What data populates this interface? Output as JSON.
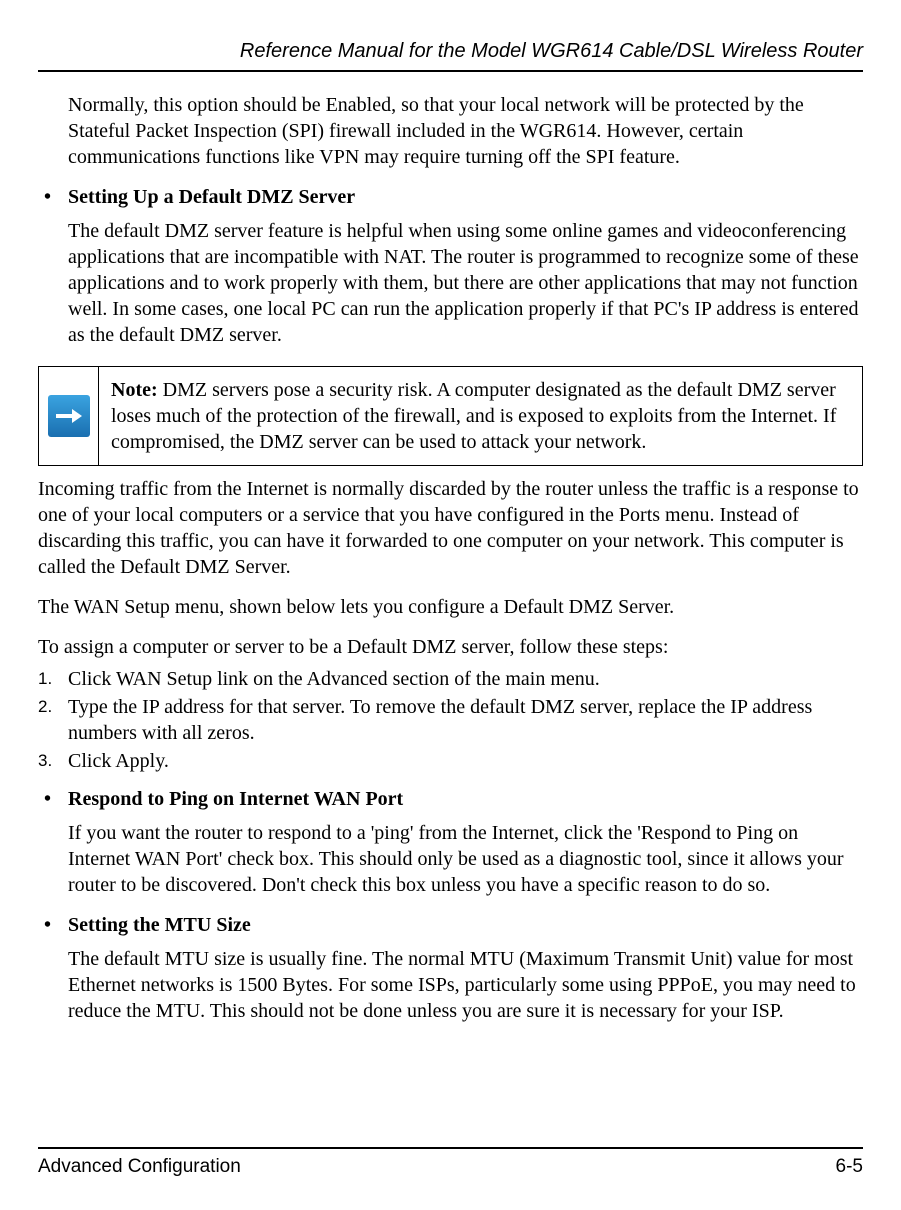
{
  "header": {
    "title": "Reference Manual for the Model WGR614 Cable/DSL Wireless Router"
  },
  "body": {
    "para_spi": "Normally, this option should be Enabled, so that your local network will be protected by the Stateful Packet Inspection (SPI) firewall included in the WGR614. However, certain communications functions like VPN may require turning off the SPI feature.",
    "bullet_dmz_heading": "Setting Up a Default DMZ Server",
    "para_dmz_intro": "The default DMZ server feature is helpful when using some online games and videoconferencing applications that are incompatible with NAT. The router is programmed to recognize some of these applications and to work properly with them, but there are other applications that may not function well. In some cases, one local PC can run the application properly if that PC's IP address is entered as the default DMZ server.",
    "note": {
      "label": "Note:",
      "text": " DMZ servers pose a security risk. A computer designated as the default DMZ server loses much of the protection of the firewall, and is exposed to exploits from the Internet. If compromised, the DMZ server can be used to attack your network."
    },
    "para_incoming": "Incoming traffic from the Internet is normally discarded by the router unless the traffic is a response to one of your local computers or a service that you have configured in the Ports menu. Instead of discarding this traffic, you can have it forwarded to one computer on your network. This computer is called the Default DMZ Server.",
    "para_wan_menu": "The WAN Setup menu, shown below lets you configure a Default DMZ Server.",
    "para_assign": "To assign a computer or server to be a Default DMZ server, follow these steps:",
    "steps": [
      "Click WAN Setup link on the Advanced section of the main menu.",
      "Type the IP address for that server. To remove the default DMZ server, replace the IP address numbers with all zeros.",
      "Click Apply."
    ],
    "bullet_ping_heading": "Respond to Ping on Internet WAN Port",
    "para_ping": "If you want the router to respond to a 'ping' from the Internet, click the 'Respond to Ping on Internet WAN Port' check box. This should only be used as a diagnostic tool, since it allows your router to be discovered. Don't check this box unless you have a specific reason to do so.",
    "bullet_mtu_heading": "Setting the MTU Size",
    "para_mtu": "The default MTU size is usually fine. The normal MTU (Maximum Transmit Unit) value for most Ethernet networks is 1500 Bytes. For some ISPs, particularly some using PPPoE, you may need to reduce the MTU. This should not be done unless you are sure it is necessary for your ISP."
  },
  "footer": {
    "section": "Advanced Configuration",
    "page": "6-5"
  }
}
